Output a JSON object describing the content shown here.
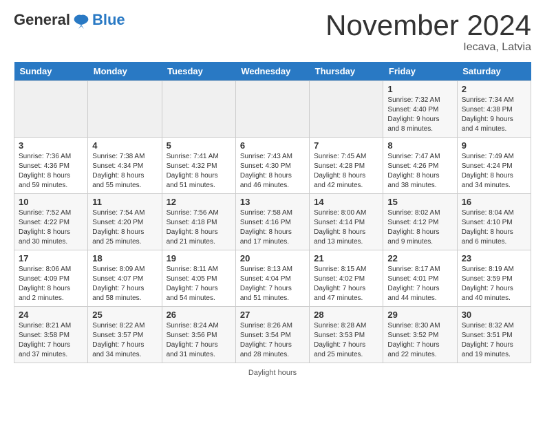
{
  "header": {
    "logo_line1": "General",
    "logo_line2": "Blue",
    "month": "November 2024",
    "location": "Iecava, Latvia"
  },
  "days_of_week": [
    "Sunday",
    "Monday",
    "Tuesday",
    "Wednesday",
    "Thursday",
    "Friday",
    "Saturday"
  ],
  "weeks": [
    [
      {
        "day": "",
        "info": ""
      },
      {
        "day": "",
        "info": ""
      },
      {
        "day": "",
        "info": ""
      },
      {
        "day": "",
        "info": ""
      },
      {
        "day": "",
        "info": ""
      },
      {
        "day": "1",
        "info": "Sunrise: 7:32 AM\nSunset: 4:40 PM\nDaylight: 9 hours\nand 8 minutes."
      },
      {
        "day": "2",
        "info": "Sunrise: 7:34 AM\nSunset: 4:38 PM\nDaylight: 9 hours\nand 4 minutes."
      }
    ],
    [
      {
        "day": "3",
        "info": "Sunrise: 7:36 AM\nSunset: 4:36 PM\nDaylight: 8 hours\nand 59 minutes."
      },
      {
        "day": "4",
        "info": "Sunrise: 7:38 AM\nSunset: 4:34 PM\nDaylight: 8 hours\nand 55 minutes."
      },
      {
        "day": "5",
        "info": "Sunrise: 7:41 AM\nSunset: 4:32 PM\nDaylight: 8 hours\nand 51 minutes."
      },
      {
        "day": "6",
        "info": "Sunrise: 7:43 AM\nSunset: 4:30 PM\nDaylight: 8 hours\nand 46 minutes."
      },
      {
        "day": "7",
        "info": "Sunrise: 7:45 AM\nSunset: 4:28 PM\nDaylight: 8 hours\nand 42 minutes."
      },
      {
        "day": "8",
        "info": "Sunrise: 7:47 AM\nSunset: 4:26 PM\nDaylight: 8 hours\nand 38 minutes."
      },
      {
        "day": "9",
        "info": "Sunrise: 7:49 AM\nSunset: 4:24 PM\nDaylight: 8 hours\nand 34 minutes."
      }
    ],
    [
      {
        "day": "10",
        "info": "Sunrise: 7:52 AM\nSunset: 4:22 PM\nDaylight: 8 hours\nand 30 minutes."
      },
      {
        "day": "11",
        "info": "Sunrise: 7:54 AM\nSunset: 4:20 PM\nDaylight: 8 hours\nand 25 minutes."
      },
      {
        "day": "12",
        "info": "Sunrise: 7:56 AM\nSunset: 4:18 PM\nDaylight: 8 hours\nand 21 minutes."
      },
      {
        "day": "13",
        "info": "Sunrise: 7:58 AM\nSunset: 4:16 PM\nDaylight: 8 hours\nand 17 minutes."
      },
      {
        "day": "14",
        "info": "Sunrise: 8:00 AM\nSunset: 4:14 PM\nDaylight: 8 hours\nand 13 minutes."
      },
      {
        "day": "15",
        "info": "Sunrise: 8:02 AM\nSunset: 4:12 PM\nDaylight: 8 hours\nand 9 minutes."
      },
      {
        "day": "16",
        "info": "Sunrise: 8:04 AM\nSunset: 4:10 PM\nDaylight: 8 hours\nand 6 minutes."
      }
    ],
    [
      {
        "day": "17",
        "info": "Sunrise: 8:06 AM\nSunset: 4:09 PM\nDaylight: 8 hours\nand 2 minutes."
      },
      {
        "day": "18",
        "info": "Sunrise: 8:09 AM\nSunset: 4:07 PM\nDaylight: 7 hours\nand 58 minutes."
      },
      {
        "day": "19",
        "info": "Sunrise: 8:11 AM\nSunset: 4:05 PM\nDaylight: 7 hours\nand 54 minutes."
      },
      {
        "day": "20",
        "info": "Sunrise: 8:13 AM\nSunset: 4:04 PM\nDaylight: 7 hours\nand 51 minutes."
      },
      {
        "day": "21",
        "info": "Sunrise: 8:15 AM\nSunset: 4:02 PM\nDaylight: 7 hours\nand 47 minutes."
      },
      {
        "day": "22",
        "info": "Sunrise: 8:17 AM\nSunset: 4:01 PM\nDaylight: 7 hours\nand 44 minutes."
      },
      {
        "day": "23",
        "info": "Sunrise: 8:19 AM\nSunset: 3:59 PM\nDaylight: 7 hours\nand 40 minutes."
      }
    ],
    [
      {
        "day": "24",
        "info": "Sunrise: 8:21 AM\nSunset: 3:58 PM\nDaylight: 7 hours\nand 37 minutes."
      },
      {
        "day": "25",
        "info": "Sunrise: 8:22 AM\nSunset: 3:57 PM\nDaylight: 7 hours\nand 34 minutes."
      },
      {
        "day": "26",
        "info": "Sunrise: 8:24 AM\nSunset: 3:56 PM\nDaylight: 7 hours\nand 31 minutes."
      },
      {
        "day": "27",
        "info": "Sunrise: 8:26 AM\nSunset: 3:54 PM\nDaylight: 7 hours\nand 28 minutes."
      },
      {
        "day": "28",
        "info": "Sunrise: 8:28 AM\nSunset: 3:53 PM\nDaylight: 7 hours\nand 25 minutes."
      },
      {
        "day": "29",
        "info": "Sunrise: 8:30 AM\nSunset: 3:52 PM\nDaylight: 7 hours\nand 22 minutes."
      },
      {
        "day": "30",
        "info": "Sunrise: 8:32 AM\nSunset: 3:51 PM\nDaylight: 7 hours\nand 19 minutes."
      }
    ]
  ],
  "daylight_note": "Daylight hours"
}
